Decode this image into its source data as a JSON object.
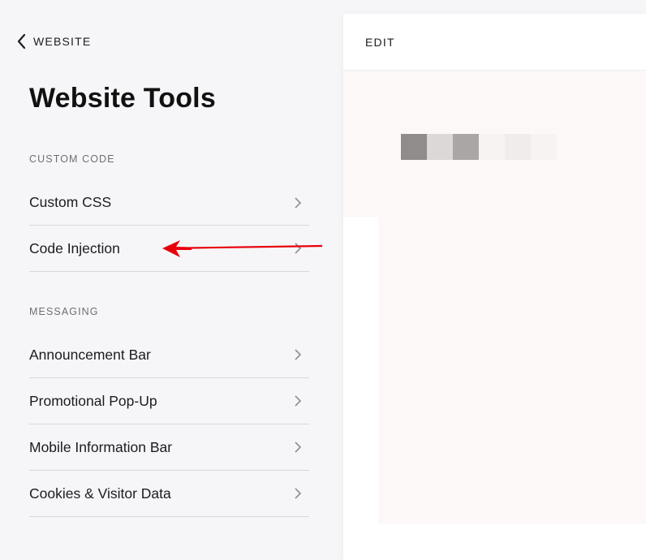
{
  "nav": {
    "back_label": "WEBSITE"
  },
  "page": {
    "title": "Website Tools"
  },
  "sections": {
    "custom_code": {
      "label": "CUSTOM CODE",
      "items": [
        {
          "label": "Custom CSS"
        },
        {
          "label": "Code Injection"
        }
      ]
    },
    "messaging": {
      "label": "MESSAGING",
      "items": [
        {
          "label": "Announcement Bar"
        },
        {
          "label": "Promotional Pop-Up"
        },
        {
          "label": "Mobile Information Bar"
        },
        {
          "label": "Cookies & Visitor Data"
        }
      ]
    }
  },
  "preview": {
    "edit_label": "EDIT"
  },
  "colors": {
    "sidebar_bg": "#f6f6f8",
    "preview_bg": "#fbf8f7",
    "annotation_arrow": "#e8000b",
    "logo_blur": [
      "#908c8b",
      "#dcd8d7",
      "#a9a6a5",
      "#f6f3f2",
      "#efeceb",
      "#f6f3f2"
    ]
  },
  "annotation": {
    "type": "arrow",
    "points_to": "Code Injection"
  }
}
